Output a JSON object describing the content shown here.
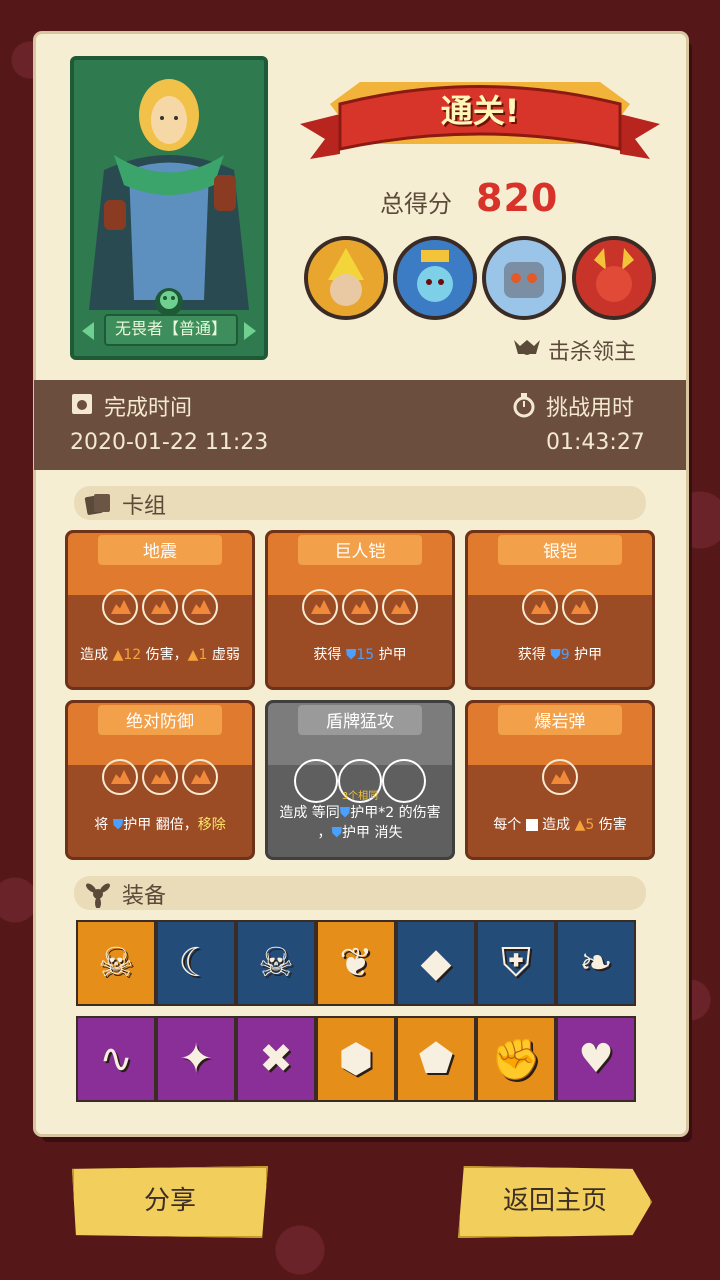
{
  "banner": {
    "title": "通关!"
  },
  "score": {
    "label": "总得分",
    "value": "820"
  },
  "hero": {
    "name": "无畏者【普通】"
  },
  "boss_label": "击杀领主",
  "times": {
    "finish_label": "完成时间",
    "finish_value": "2020-01-22 11:23",
    "challenge_label": "挑战用时",
    "challenge_value": "01:43:27"
  },
  "deck": {
    "title": "卡组",
    "cards": [
      {
        "name": "地震",
        "desc_a": "造成 ",
        "desc_b": "12",
        "desc_c": " 伤害，",
        "desc_d": "1",
        "desc_e": " 虚弱"
      },
      {
        "name": "巨人铠",
        "desc_a": "获得 ",
        "desc_b": "15",
        "desc_c": " 护甲"
      },
      {
        "name": "银铠",
        "desc_a": "获得 ",
        "desc_b": "9",
        "desc_c": " 护甲"
      },
      {
        "name": "绝对防御",
        "desc_a": "将 ",
        "desc_b": "护甲",
        "desc_c": " 翻倍，",
        "desc_d": "移除"
      },
      {
        "name": "盾牌猛攻",
        "note": "3个相同",
        "line1_a": "造成 等同",
        "line1_b": "护甲",
        "line1_c": "*2 的伤害",
        "line2_a": "，",
        "line2_b": "护甲",
        "line2_c": " 消失"
      },
      {
        "name": "爆岩弹",
        "desc_a": "每个 ",
        "desc_b": " 造成 ",
        "desc_c": "5",
        "desc_d": " 伤害"
      }
    ]
  },
  "equipment": {
    "title": "装备",
    "row1": [
      "skull-mask-icon",
      "moon-staff-icon",
      "skull-icon",
      "feather-icon",
      "crystal-boot-icon",
      "shield-icon",
      "leaves-icon"
    ],
    "row2": [
      "snake-icon",
      "crystal-gem-icon",
      "broken-stone-icon",
      "green-stone-icon",
      "blue-gem-icon",
      "red-gauntlet-icon",
      "heart-amulet-icon"
    ],
    "row1_colors": [
      "#e58f1a",
      "#234c79",
      "#234c79",
      "#e58f1a",
      "#234c79",
      "#234c79",
      "#234c79"
    ],
    "row2_colors": [
      "#8a2f98",
      "#8a2f98",
      "#8a2f98",
      "#e58f1a",
      "#e58f1a",
      "#e58f1a",
      "#8a2f98"
    ]
  },
  "buttons": {
    "share": "分享",
    "home": "返回主页"
  }
}
